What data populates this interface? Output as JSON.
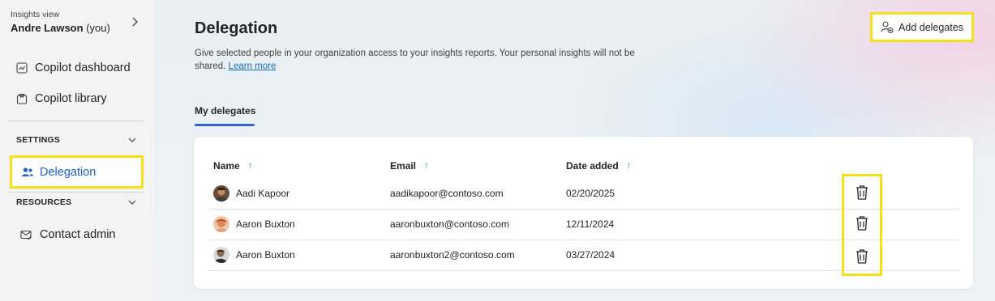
{
  "sidebar": {
    "view_label": "Insights view",
    "user_name": "Andre Lawson",
    "user_suffix": "(you)",
    "nav": [
      {
        "label": "Copilot dashboard",
        "icon": "dashboard-icon"
      },
      {
        "label": "Copilot library",
        "icon": "library-icon"
      }
    ],
    "settings_label": "SETTINGS",
    "active_item": "Delegation",
    "resources_label": "RESOURCES",
    "contact_admin": "Contact admin"
  },
  "main": {
    "title": "Delegation",
    "description": "Give selected people in your organization access to your insights reports. Your personal insights will not be shared.",
    "learn_more": "Learn more",
    "add_button": "Add delegates",
    "tab_label": "My delegates",
    "columns": {
      "name": "Name",
      "email": "Email",
      "date": "Date added"
    },
    "sort_arrow": "↑",
    "rows": [
      {
        "name": "Aadi Kapoor",
        "email": "aadikapoor@contoso.com",
        "date": "02/20/2025"
      },
      {
        "name": "Aaron Buxton",
        "email": "aaronbuxton@contoso.com",
        "date": "12/11/2024"
      },
      {
        "name": "Aaron Buxton",
        "email": "aaronbuxton2@contoso.com",
        "date": "03/27/2024"
      }
    ]
  },
  "colors": {
    "accent": "#1f5fc9",
    "highlight": "#f5e11a",
    "sort_arrow": "#2e9f6b",
    "tab_underline": "#3b63c9"
  }
}
